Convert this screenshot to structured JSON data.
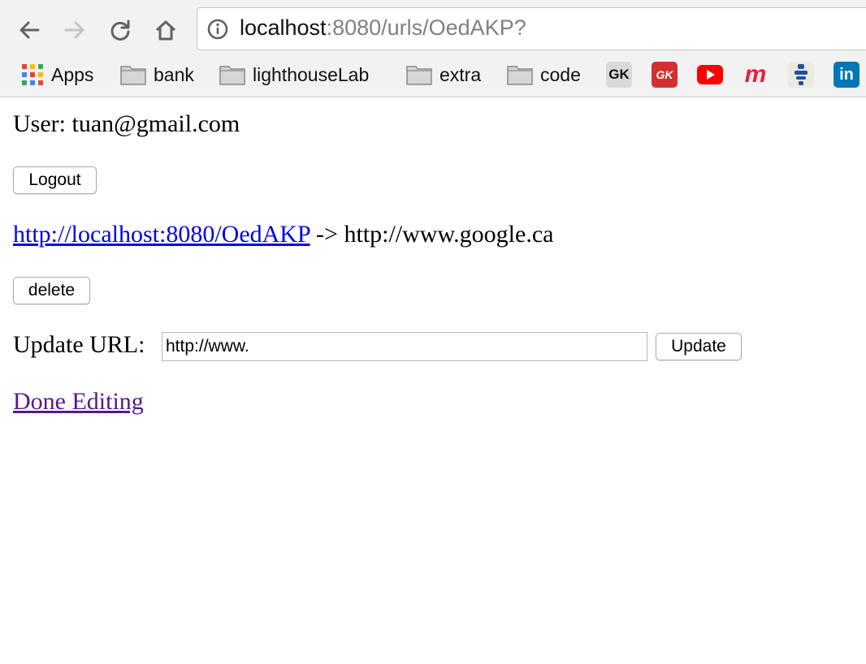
{
  "browser": {
    "address_bar": {
      "host": "localhost",
      "path": ":8080/urls/OedAKP?"
    },
    "bookmarks": [
      {
        "label": "Apps",
        "icon": "apps-grid-icon"
      },
      {
        "label": "bank",
        "icon": "folder-icon"
      },
      {
        "label": "lighthouseLab",
        "icon": "folder-icon"
      },
      {
        "label": "extra",
        "icon": "folder-icon"
      },
      {
        "label": "code",
        "icon": "folder-icon"
      }
    ],
    "favicons": [
      {
        "name": "gk-gray-icon",
        "text": "GK"
      },
      {
        "name": "gk-red-icon",
        "text": "GK"
      },
      {
        "name": "youtube-icon"
      },
      {
        "name": "meetup-icon",
        "text": "m"
      },
      {
        "name": "bookmark-site-icon"
      },
      {
        "name": "linkedin-icon",
        "text": "in"
      }
    ]
  },
  "page": {
    "user_label": "User: tuan@gmail.com",
    "logout_label": "Logout",
    "short_url": "http://localhost:8080/OedAKP",
    "long_url_text": " -> http://www.google.ca",
    "delete_label": "delete",
    "update_label": "Update URL:",
    "update_input_value": "http://www.",
    "update_button_label": "Update",
    "done_link_label": "Done Editing"
  },
  "colors": {
    "link": "#0000ee",
    "visited_link": "#551a8b",
    "youtube": "#ff0000",
    "meetup": "#ed1c40",
    "linkedin": "#0077b5"
  }
}
